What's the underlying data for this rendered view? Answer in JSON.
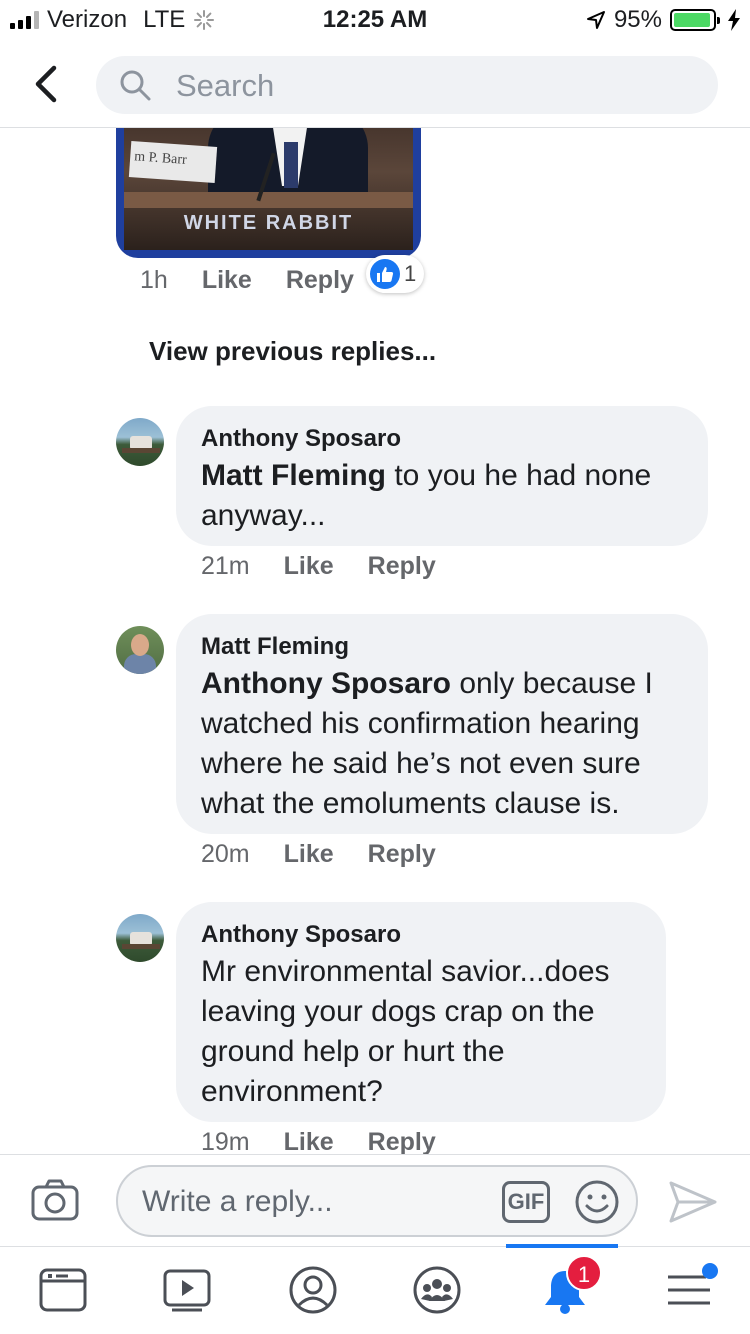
{
  "status_bar": {
    "carrier": "Verizon",
    "network": "LTE",
    "time": "12:25 AM",
    "battery_percent_label": "95%",
    "battery_level": 0.95
  },
  "header": {
    "search_placeholder": "Search"
  },
  "previous_comment": {
    "image_nameplate": "m P. Barr",
    "image_watermark": "WHITE RABBIT",
    "time": "1h",
    "like_label": "Like",
    "reply_label": "Reply",
    "reaction_count": "1"
  },
  "view_previous_replies": "View previous replies...",
  "comments": [
    {
      "author": "Anthony Sposaro",
      "mention": "Matt Fleming",
      "text": " to you he had none anyway...",
      "time": "21m",
      "like_label": "Like",
      "reply_label": "Reply"
    },
    {
      "author": "Matt Fleming",
      "mention": "Anthony Sposaro",
      "text": " only because I watched his confirmation hearing where he said he’s not even sure what the emoluments clause is.",
      "time": "20m",
      "like_label": "Like",
      "reply_label": "Reply"
    },
    {
      "author": "Anthony Sposaro",
      "mention": "",
      "text": "Mr environmental savior...does leaving your dogs crap on the ground help or hurt the environment?",
      "time": "19m",
      "like_label": "Like",
      "reply_label": "Reply"
    }
  ],
  "composer": {
    "placeholder": "Write a reply...",
    "gif_label": "GIF"
  },
  "tabbar": {
    "notifications_count": "1",
    "icons": [
      "news-feed-icon",
      "watch-icon",
      "profile-icon",
      "groups-icon",
      "notifications-bell-icon",
      "menu-icon"
    ]
  },
  "colors": {
    "accent": "#1877f2",
    "bubble": "#f0f2f5",
    "meta_text": "#65676b",
    "badge": "#e41e3f",
    "battery": "#4cd964"
  }
}
